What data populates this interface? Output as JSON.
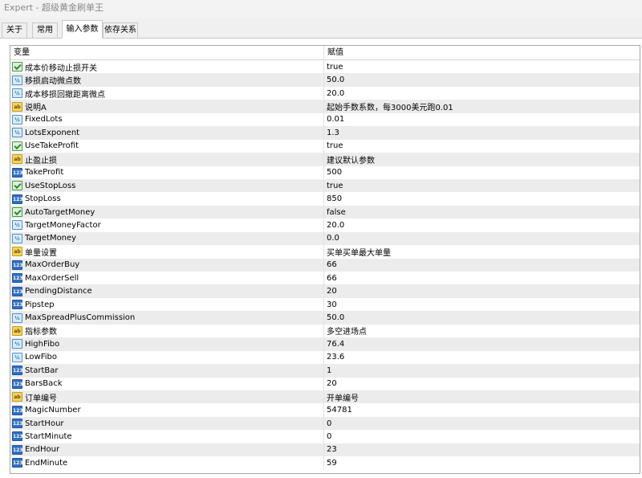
{
  "window": {
    "title": "Expert - 超级黄金刷单王"
  },
  "tabs": [
    {
      "label": "关于"
    },
    {
      "label": "常用"
    },
    {
      "label": "输入参数"
    },
    {
      "label": "依存关系"
    }
  ],
  "grid": {
    "headers": {
      "variable": "变量",
      "value": "赋值"
    },
    "rows": [
      {
        "type": "bool",
        "name": "成本价移动止损开关",
        "value": "true"
      },
      {
        "type": "double",
        "name": "移损启动微点数",
        "value": "50.0"
      },
      {
        "type": "double",
        "name": "成本移损回撤距离微点",
        "value": "20.0"
      },
      {
        "type": "string",
        "name": "说明A",
        "value": "起始手数系数，每3000美元跑0.01"
      },
      {
        "type": "double",
        "name": "FixedLots",
        "value": "0.01"
      },
      {
        "type": "double",
        "name": "LotsExponent",
        "value": "1.3"
      },
      {
        "type": "bool",
        "name": "UseTakeProfit",
        "value": "true"
      },
      {
        "type": "string",
        "name": "止盈止损",
        "value": "建议默认参数"
      },
      {
        "type": "int",
        "name": "TakeProfit",
        "value": "500"
      },
      {
        "type": "bool",
        "name": "UseStopLoss",
        "value": "true"
      },
      {
        "type": "int",
        "name": "StopLoss",
        "value": "850"
      },
      {
        "type": "bool",
        "name": "AutoTargetMoney",
        "value": "false"
      },
      {
        "type": "double",
        "name": "TargetMoneyFactor",
        "value": "20.0"
      },
      {
        "type": "double",
        "name": "TargetMoney",
        "value": "0.0"
      },
      {
        "type": "string",
        "name": "单量设置",
        "value": "买单买单最大单量"
      },
      {
        "type": "int",
        "name": "MaxOrderBuy",
        "value": "66"
      },
      {
        "type": "int",
        "name": "MaxOrderSell",
        "value": "66"
      },
      {
        "type": "int",
        "name": "PendingDistance",
        "value": "20"
      },
      {
        "type": "int",
        "name": "Pipstep",
        "value": "30"
      },
      {
        "type": "double",
        "name": "MaxSpreadPlusCommission",
        "value": "50.0"
      },
      {
        "type": "string",
        "name": "指标参数",
        "value": "多空进场点"
      },
      {
        "type": "double",
        "name": "HighFibo",
        "value": "76.4"
      },
      {
        "type": "double",
        "name": "LowFibo",
        "value": "23.6"
      },
      {
        "type": "int",
        "name": "StartBar",
        "value": "1"
      },
      {
        "type": "int",
        "name": "BarsBack",
        "value": "20"
      },
      {
        "type": "string",
        "name": "订单编号",
        "value": "开单编号"
      },
      {
        "type": "int",
        "name": "MagicNumber",
        "value": "54781"
      },
      {
        "type": "int",
        "name": "StartHour",
        "value": "0"
      },
      {
        "type": "int",
        "name": "StartMinute",
        "value": "0"
      },
      {
        "type": "int",
        "name": "EndHour",
        "value": "23"
      },
      {
        "type": "int",
        "name": "EndMinute",
        "value": "59"
      }
    ]
  }
}
